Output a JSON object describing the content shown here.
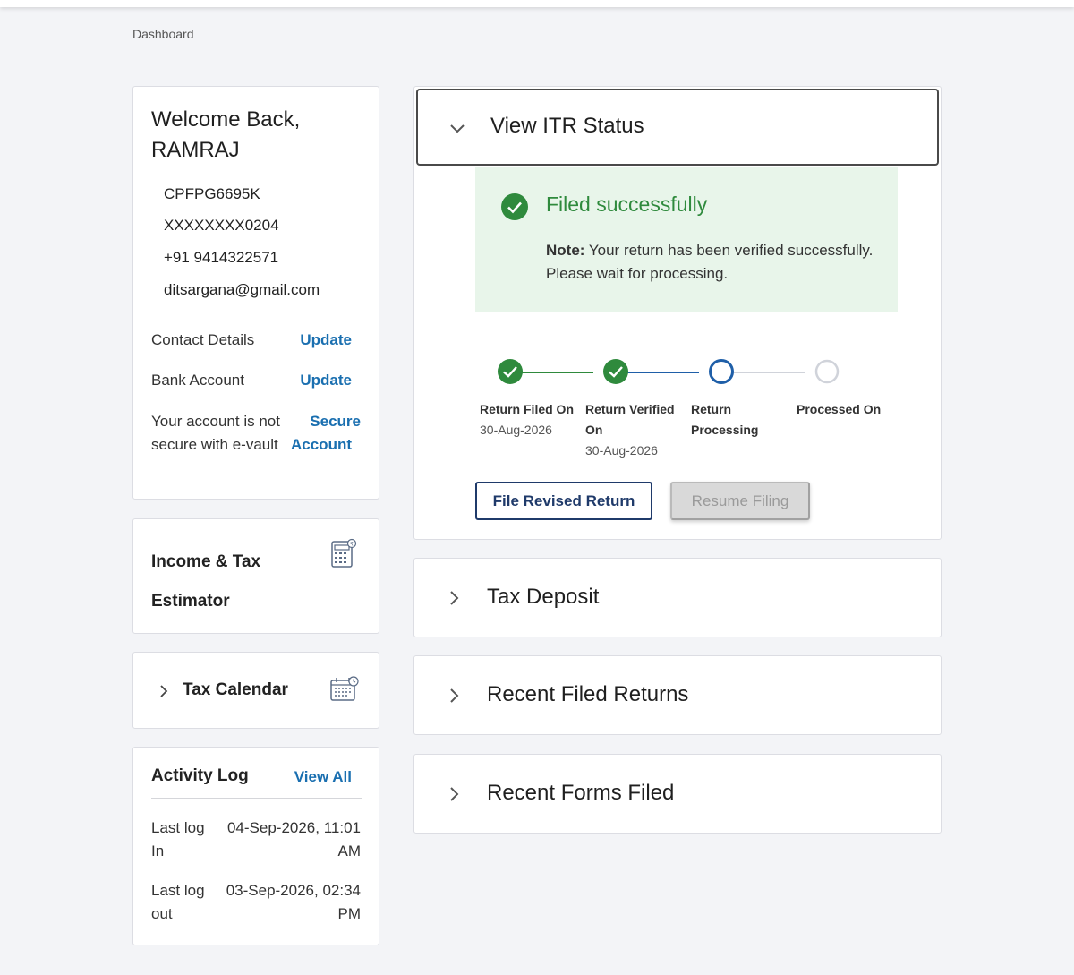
{
  "breadcrumb": "Dashboard",
  "welcome": {
    "title": "Welcome Back, RAMRAJ",
    "pan": "CPFPG6695K",
    "aadhaar": "XXXXXXXX0204",
    "phone": "+91 9414322571",
    "email": "ditsargana@gmail.com",
    "contact_label": "Contact Details",
    "contact_link": "Update",
    "bank_label": "Bank Account",
    "bank_link": "Update",
    "secure_label_1": "Your account is not",
    "secure_label_2": "secure with e-vault",
    "secure_link_1": "Secure",
    "secure_link_2": "Account"
  },
  "estimator": {
    "line1": "Income & Tax",
    "line2": "Estimator",
    "icon": "calculator-icon"
  },
  "calendar": {
    "label": "Tax Calendar",
    "icon": "calendar-icon"
  },
  "activity": {
    "title": "Activity Log",
    "view_all": "View All",
    "login_label_1": "Last log",
    "login_label_2": "In",
    "login_value_1": "04-Sep-2026, 11:01",
    "login_value_2": "AM",
    "logout_label_1": "Last log",
    "logout_label_2": "out",
    "logout_value_1": "03-Sep-2026, 02:34",
    "logout_value_2": "PM"
  },
  "itr": {
    "title": "View ITR Status",
    "status": "Filed successfully",
    "note_bold": "Note:",
    "note_text": " Your return has been verified successfully. Please wait for processing.",
    "steps": [
      {
        "label": "Return Filed On",
        "date": "30-Aug-2026",
        "state": "done"
      },
      {
        "label": "Return Verified On",
        "date": "30-Aug-2026",
        "state": "done"
      },
      {
        "label": "Return Processing",
        "date": "",
        "state": "current"
      },
      {
        "label": "Processed On",
        "date": "",
        "state": "pending"
      }
    ],
    "btn_revised": "File Revised Return",
    "btn_resume": "Resume Filing"
  },
  "accordions": {
    "tax_deposit": "Tax Deposit",
    "recent_returns": "Recent Filed Returns",
    "recent_forms": "Recent Forms Filed"
  },
  "colors": {
    "success_green": "#2f8a3d",
    "link_blue": "#1a6fb0",
    "progress_blue": "#1f5fa8",
    "success_bg": "#e8f5ea"
  }
}
